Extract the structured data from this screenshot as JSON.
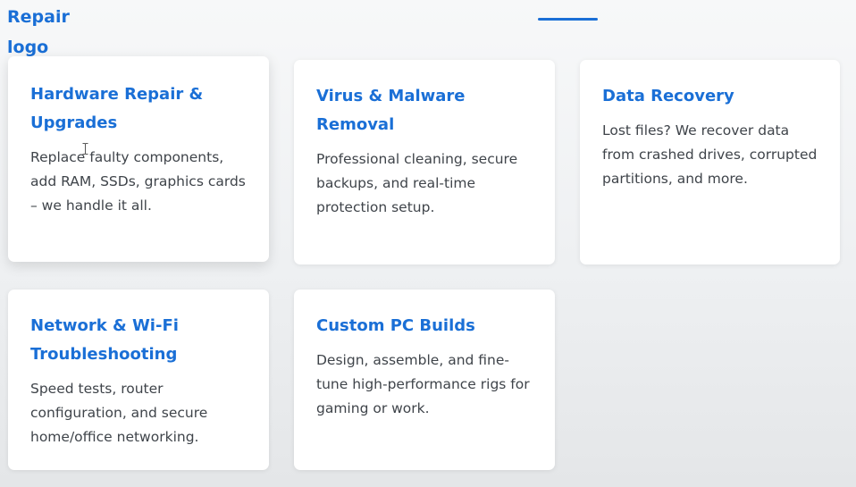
{
  "header": {
    "logo_text": "Repair logo"
  },
  "nav": {
    "active_indicator_color": "#1a6fd6"
  },
  "colors": {
    "accent": "#1a6fd6",
    "body_text": "#3f444a",
    "card_bg": "#ffffff"
  },
  "services": [
    {
      "title": "Hardware Repair & Upgrades",
      "description": "Replace faulty components, add RAM, SSDs, graphics cards – we handle it all."
    },
    {
      "title": "Virus & Malware Removal",
      "description": "Professional cleaning, secure backups, and real-time protection setup."
    },
    {
      "title": "Data Recovery",
      "description": "Lost files? We recover data from crashed drives, corrupted partitions, and more."
    },
    {
      "title": "Network & Wi-Fi Troubleshooting",
      "description": "Speed tests, router configuration, and secure home/office networking."
    },
    {
      "title": "Custom PC Builds",
      "description": "Design, assemble, and fine-tune high-performance rigs for gaming or work."
    }
  ],
  "cursor": {
    "icon": "text-cursor-icon"
  }
}
